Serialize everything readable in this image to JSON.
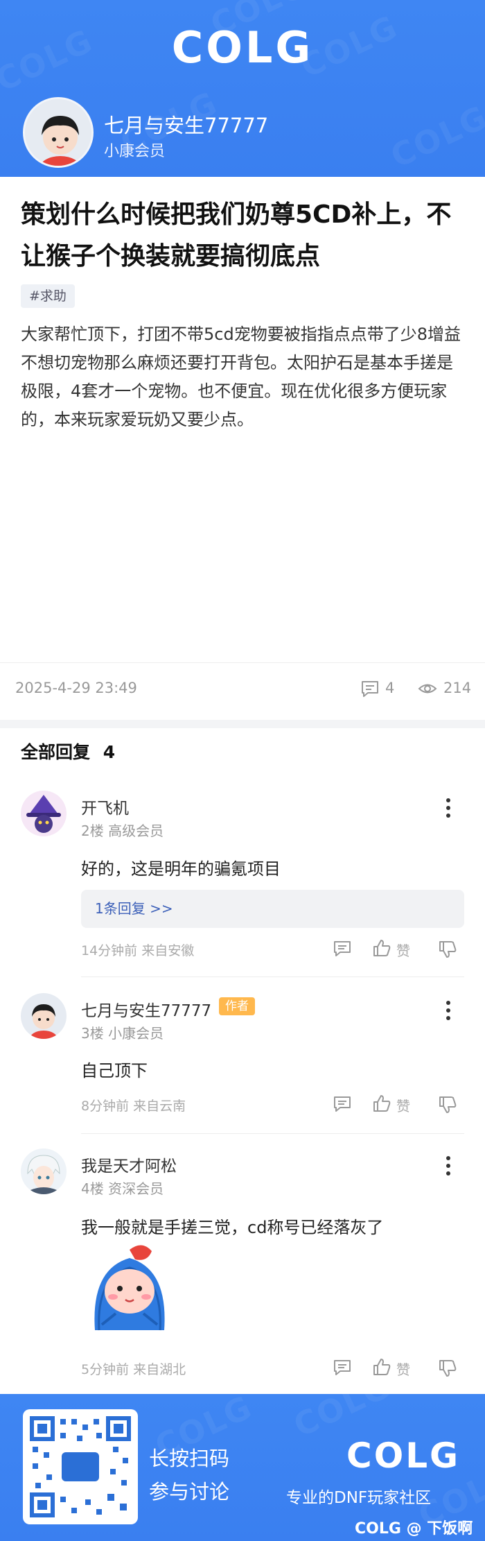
{
  "header": {
    "logo": "COLG",
    "author_name": "七月与安生77777",
    "author_level": "小康会员"
  },
  "post": {
    "title": "策划什么时候把我们奶尊5CD补上，不让猴子个换装就要搞彻底点",
    "tag": "#求助",
    "body": "大家帮忙顶下，打团不带5cd宠物要被指指点点带了少8增益 不想切宠物那么麻烦还要打开背包。太阳护石是基本手搓是极限，4套才一个宠物。也不便宜。现在优化很多方便玩家的，本来玩家爱玩奶又要少点。",
    "date": "2025-4-29 23:49",
    "comment_count": "4",
    "view_count": "214"
  },
  "replies_header": {
    "label": "全部回复",
    "count": "4"
  },
  "replies": [
    {
      "name": "开飞机",
      "meta": "2楼 高级会员",
      "text": "好的，这是明年的骗氪项目",
      "sub_reply": "1条回复 >>",
      "time_loc": "14分钟前 来自安徽",
      "like_label": "赞"
    },
    {
      "name": "七月与安生77777",
      "badge": "作者",
      "meta": "3楼 小康会员",
      "text": "自己顶下",
      "time_loc": "8分钟前 来自云南",
      "like_label": "赞"
    },
    {
      "name": "我是天才阿松",
      "meta": "4楼 资深会员",
      "text": "我一般就是手搓三觉，cd称号已经落灰了",
      "time_loc": "5分钟前 来自湖北",
      "like_label": "赞"
    }
  ],
  "footer": {
    "qr_line1": "长按扫码",
    "qr_line2": "参与讨论",
    "logo": "COLG",
    "slogan": "专业的DNF玩家社区",
    "credit": "COLG @ 下饭啊"
  },
  "colors": {
    "brand_blue": "#3d84f2",
    "author_badge": "#ffb84d",
    "link_blue": "#3b5fb8"
  }
}
